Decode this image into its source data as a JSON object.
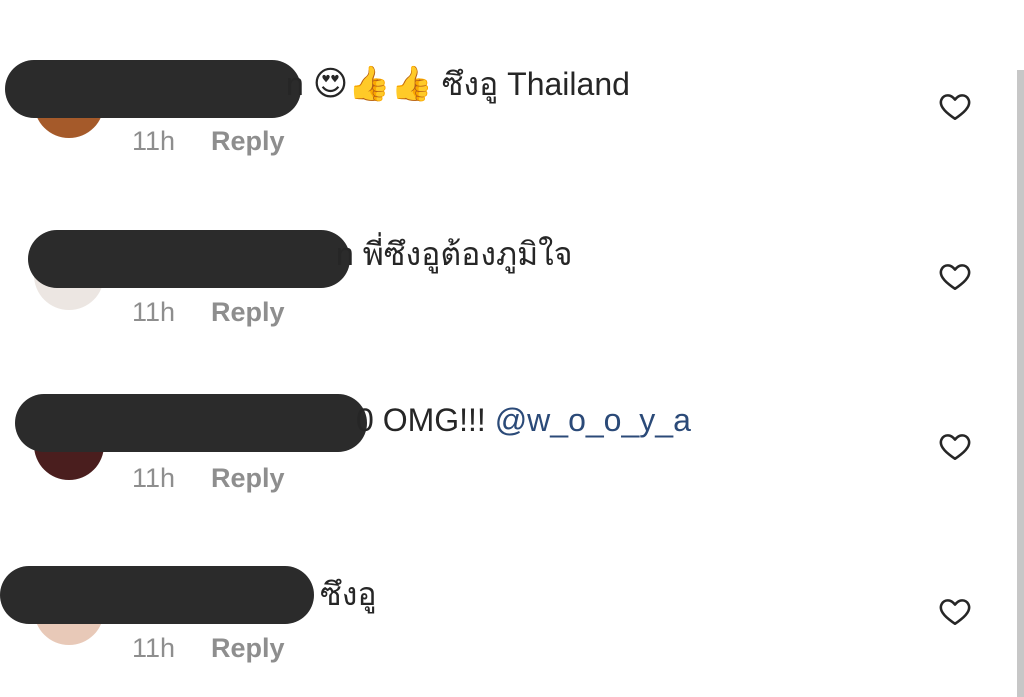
{
  "comments": [
    {
      "fragment": "n",
      "emojis": "😍👍👍",
      "text": " ซึงอู Thailand",
      "mention": "",
      "time": "11h",
      "reply_label": "Reply",
      "avatar_color": "#a55a2a"
    },
    {
      "fragment": "n",
      "emojis": "",
      "text": " พี่ซึงอูต้องภูมิใจ",
      "mention": "",
      "time": "11h",
      "reply_label": "Reply",
      "avatar_color": "#ece6e2"
    },
    {
      "fragment": "0",
      "emojis": "",
      "text": " OMG!!! ",
      "mention": "@w_o_o_y_a",
      "time": "11h",
      "reply_label": "Reply",
      "avatar_color": "#4a1e1e"
    },
    {
      "fragment": "",
      "emojis": "",
      "text": "ซึงอู",
      "mention": "",
      "time": "11h",
      "reply_label": "Reply",
      "avatar_color": "#e8c9b8"
    }
  ],
  "colors": {
    "text": "#262626",
    "meta": "#8e8e8e",
    "mention": "#2b4a78",
    "redaction": "#2b2b2b"
  },
  "icons": {
    "like": "heart-outline-icon"
  }
}
